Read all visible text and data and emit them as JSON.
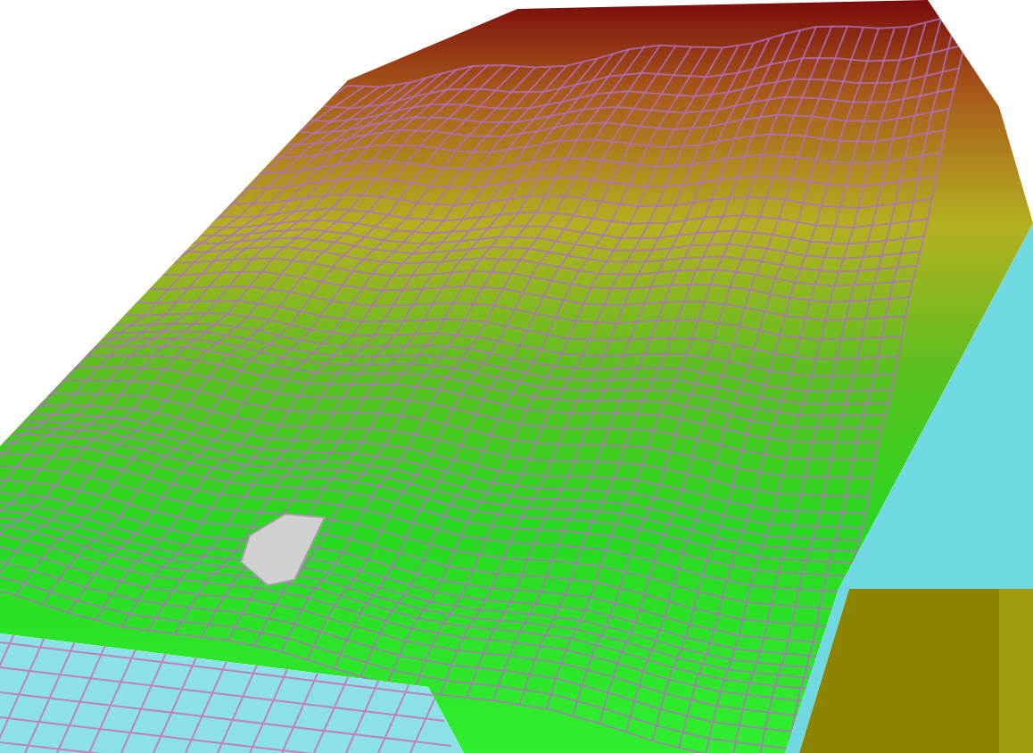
{
  "scene": {
    "kind": "terrain-mesh"
  }
}
